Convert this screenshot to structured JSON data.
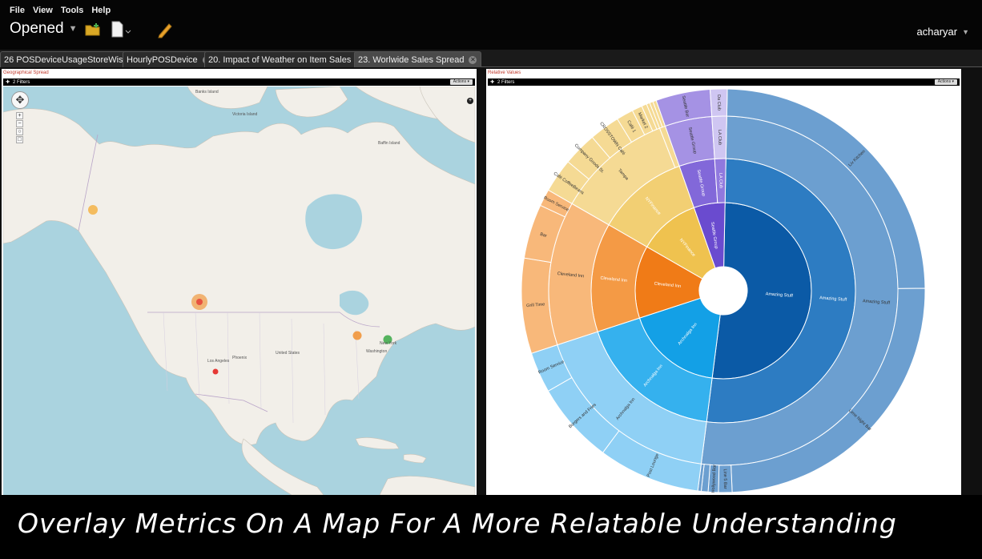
{
  "menu": {
    "file": "File",
    "view": "View",
    "tools": "Tools",
    "help": "Help"
  },
  "toolbar": {
    "opened_label": "Opened"
  },
  "user": {
    "name": "acharyar"
  },
  "tabs": [
    {
      "label": "26 POSDeviceUsageStoreWise",
      "active": false
    },
    {
      "label": "HourlyPOSDevice",
      "active": false
    },
    {
      "label": "20. Impact of Weather on Item Sales",
      "active": false
    },
    {
      "label": "23. Worlwide Sales Spread",
      "active": true
    }
  ],
  "map_panel": {
    "title": "Geographical Spread",
    "filters": "2 Filters",
    "actions": "Actions",
    "places": [
      "Banks Island",
      "Victoria Island",
      "Baffin Island",
      "United States",
      "Los Angeles",
      "Phoenix",
      "New York",
      "Washington"
    ],
    "markers": [
      {
        "name": "alaska-marker",
        "color": "#f5a623"
      },
      {
        "name": "seattle-marker",
        "color": "#f08a24"
      },
      {
        "name": "los-angeles-marker",
        "color": "#e53935"
      },
      {
        "name": "cleveland-marker",
        "color": "#f08a24"
      },
      {
        "name": "new-york-marker",
        "color": "#3aa845"
      }
    ]
  },
  "sun_panel": {
    "title": "Relative Values",
    "filters": "2 Filters",
    "actions": "Actions"
  },
  "chart_data": {
    "type": "sunburst",
    "title": "Relative Values",
    "children": [
      {
        "name": "Amazing Stuff",
        "color": "#0b5aa6",
        "children": [
          {
            "name": "Amazing Stuff",
            "color": "#2d7cc2",
            "children": [
              {
                "name": "Amazing Stuff",
                "color": "#6c9fd0",
                "children": [
                  {
                    "name": "Liv Kitchen",
                    "value": 90
                  },
                  {
                    "name": "Lime Night Bar",
                    "value": 90
                  },
                  {
                    "name": "Line 5 Bar",
                    "value": 4
                  },
                  {
                    "name": "Hollywood Bar",
                    "value": 3
                  },
                  {
                    "name": "Best Seattle Bar",
                    "value": 2
                  },
                  {
                    "name": "",
                    "value": 1
                  }
                ]
              }
            ]
          }
        ]
      },
      {
        "name": "Archnalga Inn",
        "color": "#13a0e6",
        "children": [
          {
            "name": "Archnalga Inn",
            "color": "#35b1ee",
            "children": [
              {
                "name": "Archnalga Inn",
                "color": "#8fd0f5",
                "children": [
                  {
                    "name": "Post Lounge",
                    "value": 30
                  },
                  {
                    "name": "Burgers and Fries",
                    "value": 24
                  },
                  {
                    "name": "Room Service",
                    "value": 12
                  }
                ]
              }
            ]
          }
        ]
      },
      {
        "name": "Cleveland Inn",
        "color": "#f07b17",
        "children": [
          {
            "name": "Cleveland Inn",
            "color": "#f49a45",
            "children": [
              {
                "name": "Cleveland Inn",
                "color": "#f8b87a",
                "children": [
                  {
                    "name": "Grill Time",
                    "value": 28
                  },
                  {
                    "name": "Bar",
                    "value": 16
                  },
                  {
                    "name": "Room Service",
                    "value": 5
                  }
                ]
              }
            ]
          }
        ]
      },
      {
        "name": "NYFinance",
        "color": "#efc24f",
        "children": [
          {
            "name": "NYFinance",
            "color": "#f2cf73",
            "children": [
              {
                "name": "Tampa",
                "color": "#f5da94",
                "children": [
                  {
                    "name": "Café CoffeeBeans",
                    "value": 10
                  },
                  {
                    "name": "Company Goods St.",
                    "value": 10
                  },
                  {
                    "name": "CROSSTOWN Café",
                    "value": 9
                  },
                  {
                    "name": "Café 1",
                    "value": 5
                  },
                  {
                    "name": "Market 2",
                    "value": 3
                  },
                  {
                    "name": "Market 1",
                    "value": 1.5
                  },
                  {
                    "name": "",
                    "value": 1
                  }
                ]
              },
              {
                "name": "Miami",
                "color": "#f5da94",
                "children": [
                  {
                    "name": "",
                    "value": 1
                  },
                  {
                    "name": "",
                    "value": 1
                  }
                ]
              }
            ]
          }
        ]
      },
      {
        "name": "Seattle Group",
        "color": "#6a4bcf",
        "children": [
          {
            "name": "Seattle Group",
            "color": "#8268d9",
            "children": [
              {
                "name": "Seattle Group",
                "color": "#a592e4",
                "children": [
                  {
                    "name": "Seattle Bar",
                    "value": 16
                  }
                ]
              }
            ]
          },
          {
            "name": "LA Club",
            "color": "#9079de",
            "children": [
              {
                "name": "LA Club",
                "color": "#cfc6f2",
                "children": [
                  {
                    "name": "Da Club",
                    "value": 5
                  }
                ]
              }
            ]
          }
        ]
      }
    ],
    "outer_labels": {
      "Miami": "Miami",
      "Los Angel": "Los Angel"
    }
  },
  "caption": "Overlay Metrics On A Map For A More Relatable Understanding"
}
